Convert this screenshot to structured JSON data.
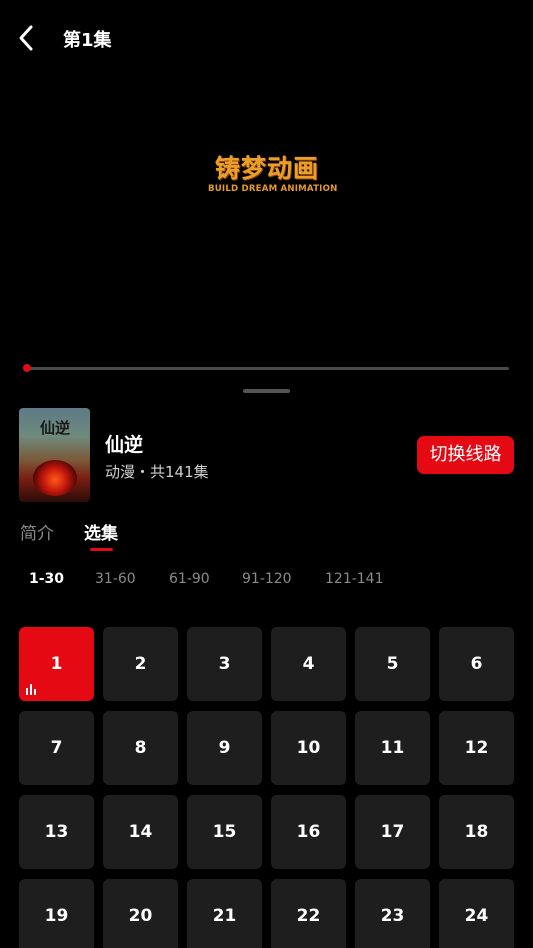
{
  "header": {
    "title": "第1集",
    "back_icon": "chevron-left-icon"
  },
  "video": {
    "logo_cn": "铸梦动画",
    "logo_en": "BUILD DREAM ANIMATION",
    "progress": 0.0
  },
  "show": {
    "poster_title": "仙逆",
    "title": "仙逆",
    "meta": "动漫・共141集",
    "switch_label": "切换线路"
  },
  "tabs": [
    {
      "label": "简介",
      "active": false
    },
    {
      "label": "选集",
      "active": true
    }
  ],
  "ranges": [
    "1-30",
    "31-60",
    "61-90",
    "91-120",
    "121-141"
  ],
  "active_range": "1-30",
  "episodes": [
    "1",
    "2",
    "3",
    "4",
    "5",
    "6",
    "7",
    "8",
    "9",
    "10",
    "11",
    "12",
    "13",
    "14",
    "15",
    "16",
    "17",
    "18",
    "19",
    "20",
    "21",
    "22",
    "23",
    "24"
  ],
  "current_episode": "1",
  "colors": {
    "accent": "#e50914",
    "tile": "#1e1e1e",
    "muted": "#8a8a8a"
  }
}
